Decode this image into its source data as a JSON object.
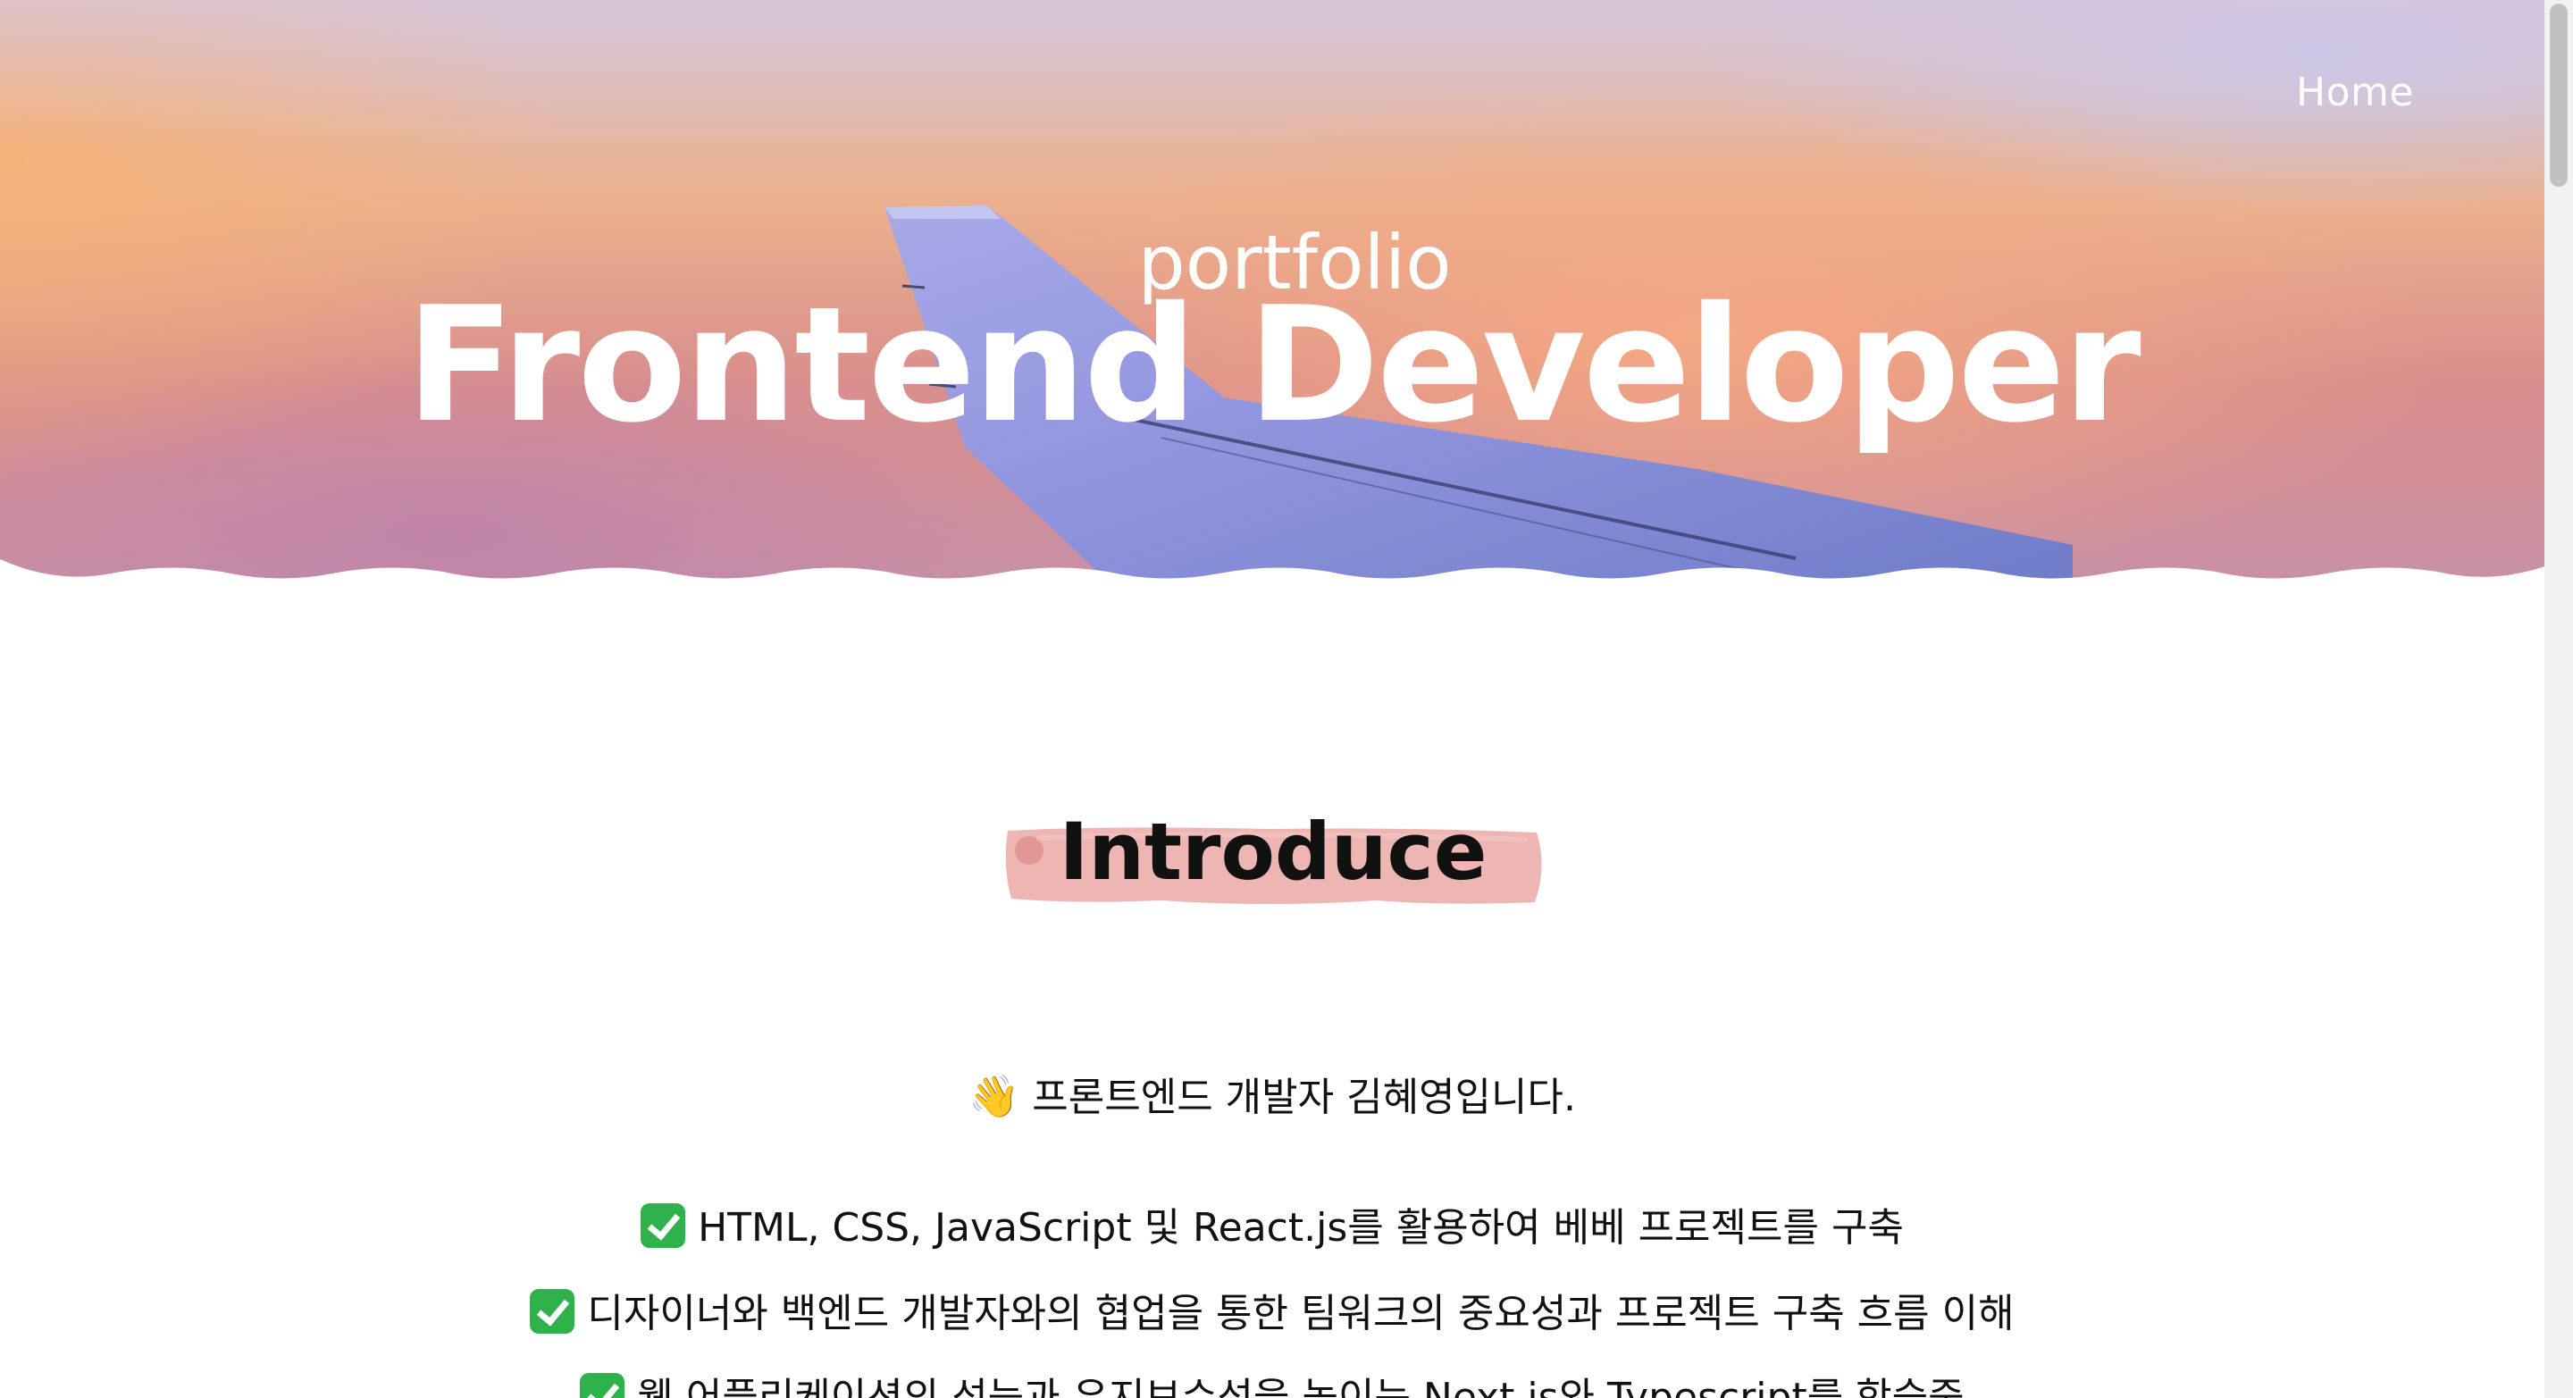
{
  "nav": {
    "home_label": "Home"
  },
  "hero": {
    "subtitle": "portfolio",
    "title": "Frontend Developer"
  },
  "introduce": {
    "heading": "Introduce",
    "greeting_emoji": "👋",
    "greeting": "프론트엔드 개발자 김혜영입니다.",
    "items": [
      "HTML, CSS, JavaScript 및 React.js를 활용하여 베베 프로젝트를 구축",
      "디자이너와 백엔드 개발자와의 협업을 통한 팀워크의 중요성과 프로젝트 구축 흐름 이해",
      "웹 어플리케이션의 성능과 유지보수성을 높이는 Next.js와 Typescript를 학습중"
    ]
  },
  "colors": {
    "hero_peach": "#ebb08e",
    "hero_mauve": "#c890a6",
    "brush_pink": "#eaa9a5",
    "check_green": "#2fb24c",
    "text_dark": "#111111"
  }
}
